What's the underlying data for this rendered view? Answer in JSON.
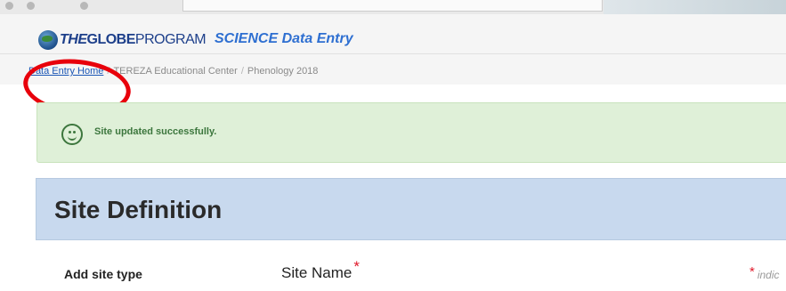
{
  "header": {
    "logo_parts": {
      "the": "THE",
      "globe": "GLOBE",
      "program": "PROGRAM"
    },
    "app_title": "SCIENCE Data Entry"
  },
  "breadcrumb": {
    "home": "Data Entry Home",
    "organization": "TEREZA Educational Center",
    "separator": "/",
    "current": "Phenology 2018"
  },
  "alert": {
    "icon": "smiley-icon",
    "message": "Site updated successfully."
  },
  "section": {
    "title": "Site Definition"
  },
  "form": {
    "add_site_type_label": "Add site type",
    "site_name_label": "Site Name",
    "required_marker": "*",
    "indicates_text": "indic"
  },
  "colors": {
    "accent": "#2e6fd1",
    "link": "#1a56b5",
    "success_bg": "#dff0d8",
    "success_text": "#3c763d",
    "section_bg": "#c8d9ee",
    "required": "#e0182a",
    "annotation": "#e8000b"
  }
}
